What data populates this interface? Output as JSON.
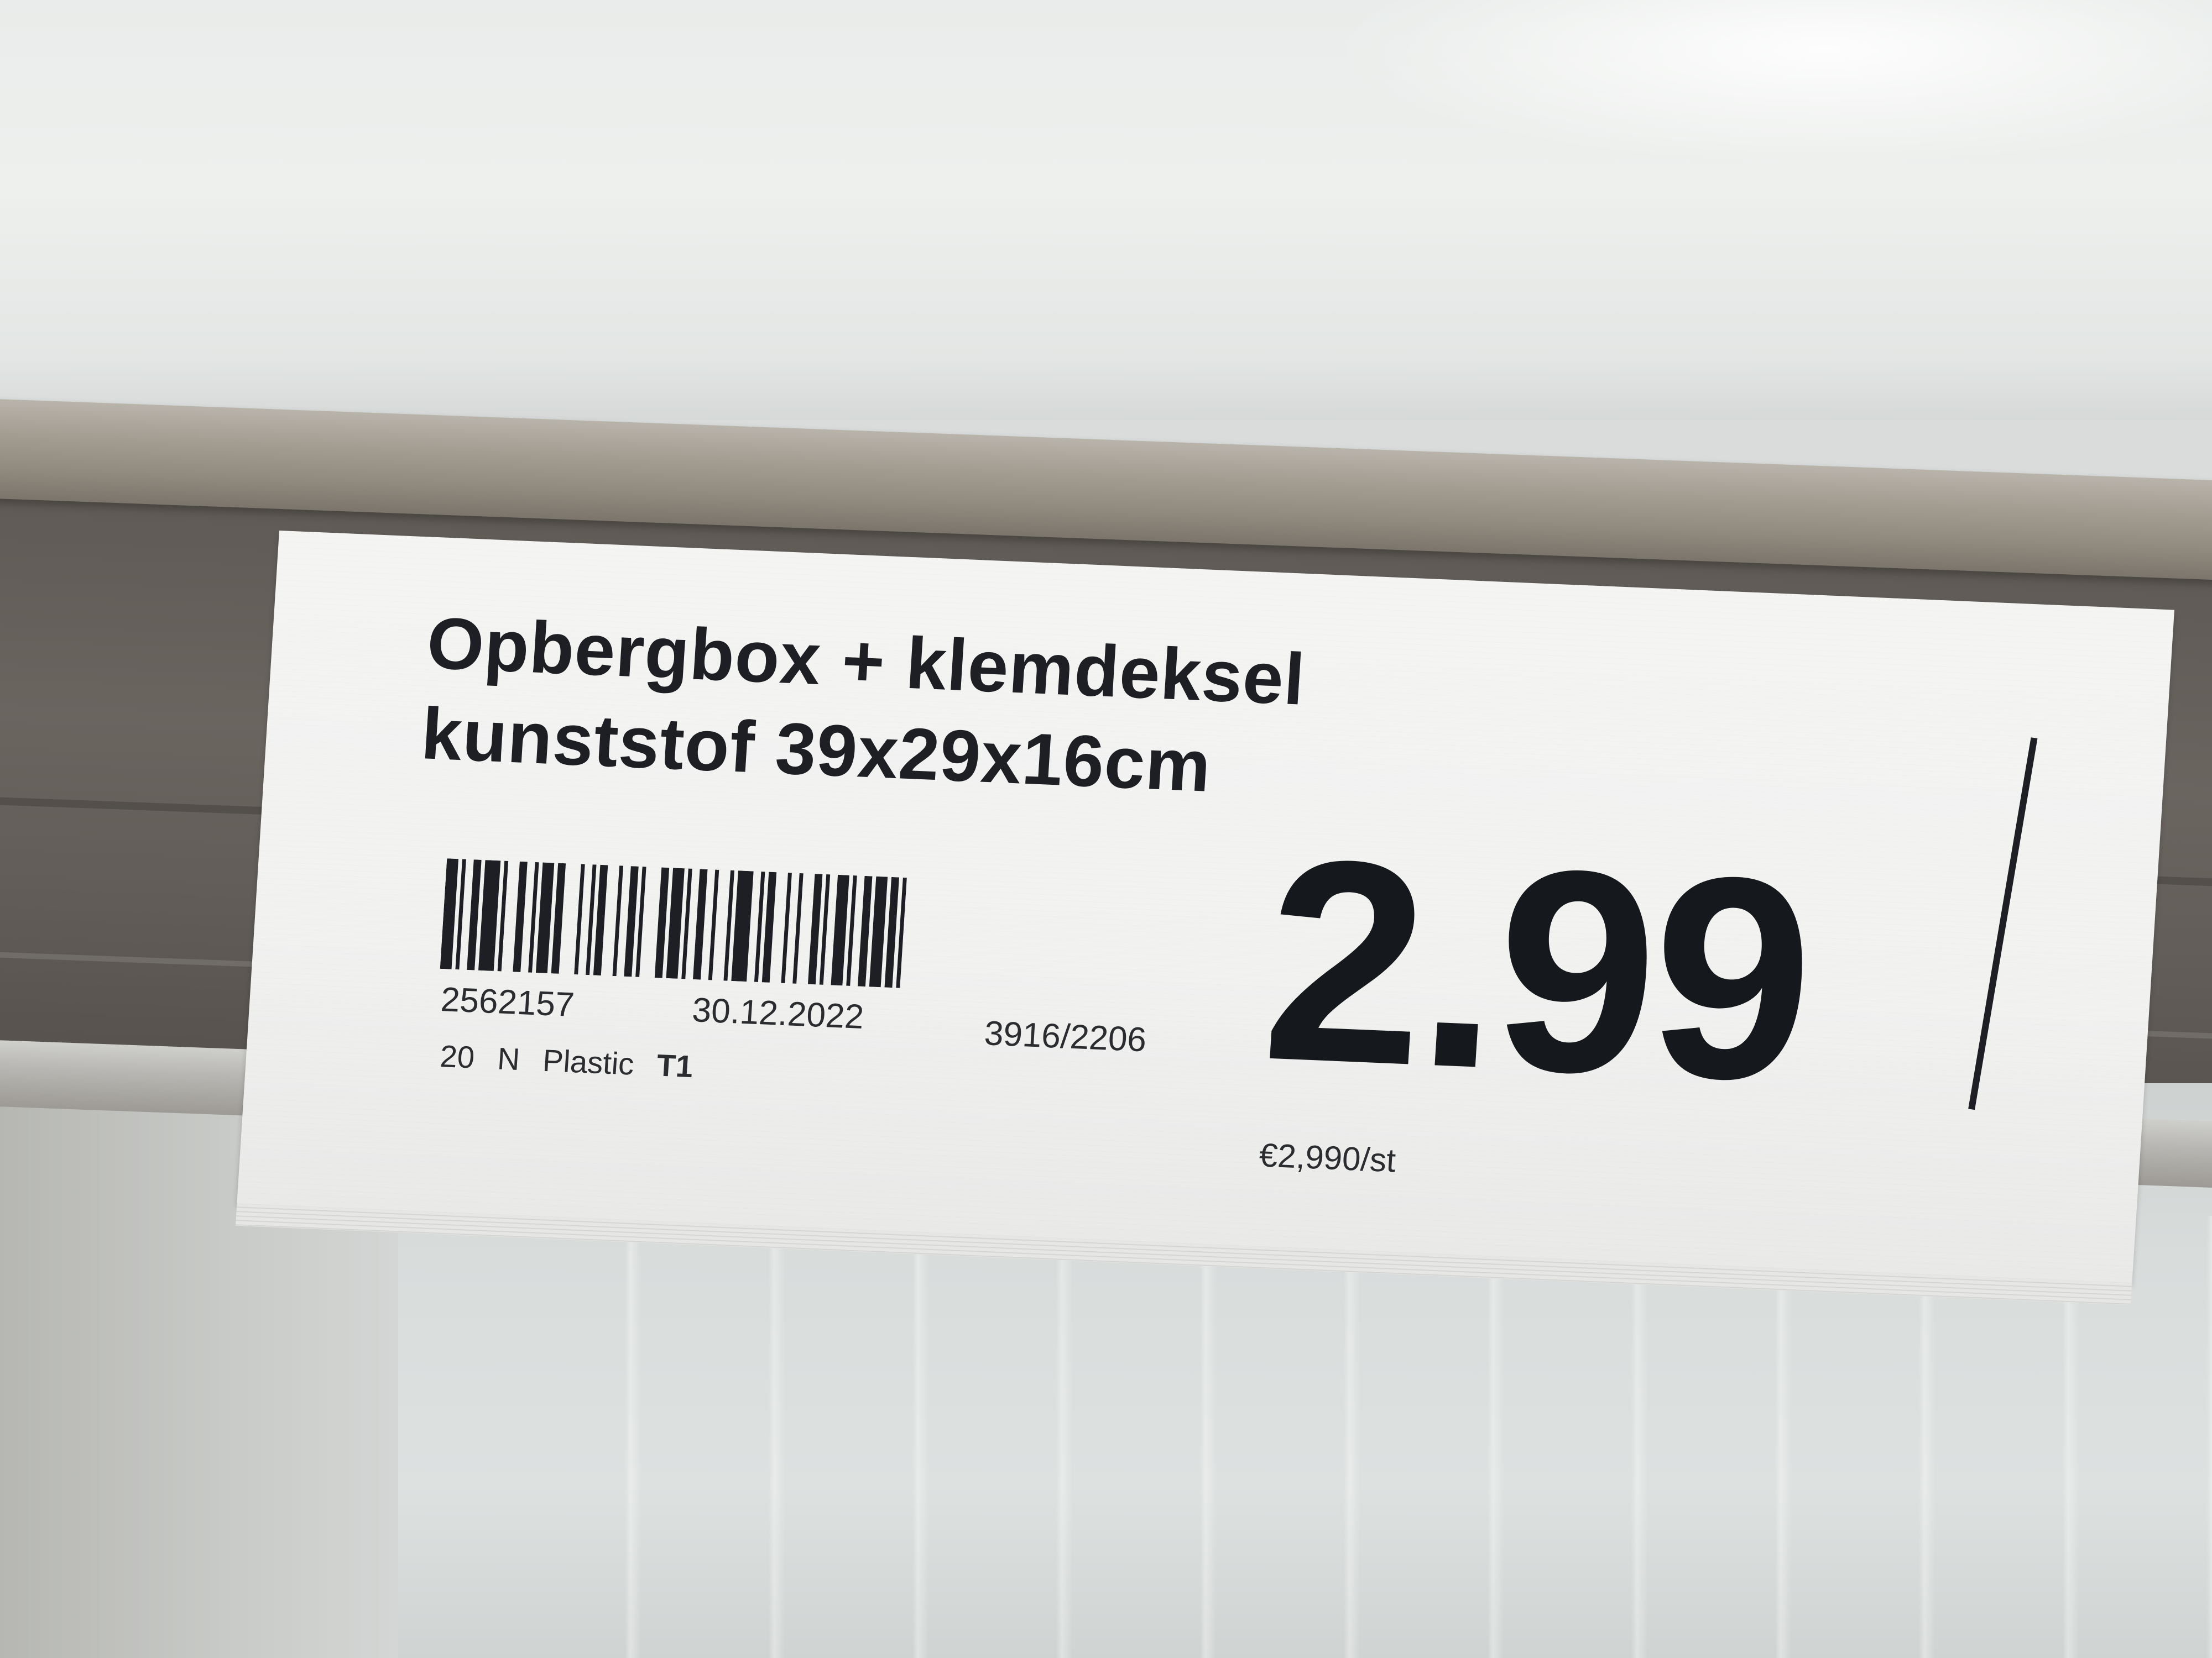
{
  "shelf_label": {
    "title_line1": "Opbergbox + klemdeksel",
    "title_line2": "kunststof 39x29x16cm",
    "article_number": "2562157",
    "date": "30.12.2022",
    "reference": "3916/2206",
    "attribute_qty": "20",
    "attribute_flag": "N",
    "attribute_material": "Plastic",
    "attribute_tag": "T1",
    "price": "2.99",
    "unit_price": "€2,990/st"
  },
  "colors": {
    "label_paper": "#f2f2f1",
    "print_ink": "#1d1f24",
    "rail": "#655f5a",
    "shelf": "#eceeed"
  }
}
